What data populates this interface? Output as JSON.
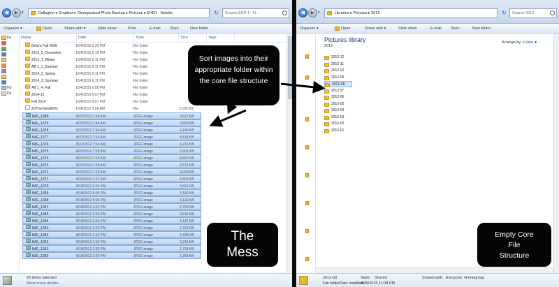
{
  "left_window": {
    "path": [
      "Gallagher",
      "Dropbox",
      "Disorganized Photo Backup",
      "Pictures",
      "EHD1 - Natalie"
    ],
    "search_placeholder": "Search EHD 1 - N...",
    "toolbar": [
      "Organize",
      "Open",
      "Share with",
      "Slide show",
      "Print",
      "E-mail",
      "Burn",
      "New folder"
    ],
    "nav_items": [
      "Fa",
      "",
      "",
      "",
      "",
      "",
      "",
      "",
      "",
      "Ho",
      "De"
    ],
    "columns": [
      "Name",
      "Date",
      "Type",
      "Size",
      "Tags"
    ],
    "rows": [
      {
        "name": "Before Fall 2009",
        "date": "10/4/2015 6:39 PM",
        "type": "File folder",
        "size": "",
        "kind": "folder",
        "selected": false
      },
      {
        "name": "2013_5_December",
        "date": "10/4/2015 6:19 PM",
        "type": "File folder",
        "size": "",
        "kind": "folder",
        "selected": false
      },
      {
        "name": "2013_1_Winter",
        "date": "10/4/2015 6:11 PM",
        "type": "File folder",
        "size": "",
        "kind": "folder",
        "selected": false
      },
      {
        "name": "AB 1_1_Summer",
        "date": "10/4/2015 6:11 PM",
        "type": "File folder",
        "size": "",
        "kind": "folder",
        "selected": false
      },
      {
        "name": "2014_2_Spring",
        "date": "10/4/2015 6:11 PM",
        "type": "File folder",
        "size": "",
        "kind": "folder",
        "selected": false
      },
      {
        "name": "2014_3_Summer",
        "date": "10/4/2015 6:11 PM",
        "type": "File folder",
        "size": "",
        "kind": "folder",
        "selected": false
      },
      {
        "name": "AB 1_4_Fall",
        "date": "10/4/2015 6:08 PM",
        "type": "File folder",
        "size": "",
        "kind": "folder",
        "selected": false
      },
      {
        "name": "2014-12",
        "date": "10/4/2015 6:07 PM",
        "type": "File folder",
        "size": "",
        "kind": "folder",
        "selected": false
      },
      {
        "name": "Fall 2014",
        "date": "10/4/2015 6:07 PM",
        "type": "File folder",
        "size": "",
        "kind": "folder",
        "selected": false
      },
      {
        "name": "ZbThumbnailInfo",
        "date": "10/4/2012 3:08 AM",
        "type": "File",
        "size": "2,285 KB",
        "kind": "file",
        "selected": false
      },
      {
        "name": "IMG_1380",
        "date": "8/22/2012 7:48 AM",
        "type": "JPEG image",
        "size": "3,527 KB",
        "kind": "image",
        "selected": true
      },
      {
        "name": "IMG_1379",
        "date": "8/22/2012 7:45 AM",
        "type": "JPEG image",
        "size": "3,559 KB",
        "kind": "image",
        "selected": true
      },
      {
        "name": "IMG_1378",
        "date": "8/22/2012 7:34 AM",
        "type": "JPEG image",
        "size": "4,140 KB",
        "kind": "image",
        "selected": true
      },
      {
        "name": "IMG_1377",
        "date": "8/22/2012 7:34 AM",
        "type": "JPEG image",
        "size": "4,518 KB",
        "kind": "image",
        "selected": true
      },
      {
        "name": "IMG_1376",
        "date": "8/22/2012 7:34 AM",
        "type": "JPEG image",
        "size": "4,219 KB",
        "kind": "image",
        "selected": true
      },
      {
        "name": "IMG_1375",
        "date": "8/22/2012 7:28 AM",
        "type": "JPEG image",
        "size": "3,902 KB",
        "kind": "image",
        "selected": true
      },
      {
        "name": "IMG_1374",
        "date": "8/22/2012 7:28 AM",
        "type": "JPEG image",
        "size": "4,665 KB",
        "kind": "image",
        "selected": true
      },
      {
        "name": "IMG_1373",
        "date": "8/22/2012 7:28 AM",
        "type": "JPEG image",
        "size": "4,572 KB",
        "kind": "image",
        "selected": true
      },
      {
        "name": "IMG_1372",
        "date": "8/22/2012 7:28 AM",
        "type": "JPEG image",
        "size": "4,029 KB",
        "kind": "image",
        "selected": true
      },
      {
        "name": "IMG_1371",
        "date": "8/22/2012 7:27 AM",
        "type": "JPEG image",
        "size": "4,501 KB",
        "kind": "image",
        "selected": true
      },
      {
        "name": "IMG_1370",
        "date": "8/18/2012 5:04 PM",
        "type": "JPEG image",
        "size": "3,551 KB",
        "kind": "image",
        "selected": true
      },
      {
        "name": "IMG_1369",
        "date": "8/18/2012 5:04 PM",
        "type": "JPEG image",
        "size": "3,180 KB",
        "kind": "image",
        "selected": true
      },
      {
        "name": "IMG_1368",
        "date": "8/18/2012 5:00 PM",
        "type": "JPEG image",
        "size": "3,100 KB",
        "kind": "image",
        "selected": true
      },
      {
        "name": "IMG_1367",
        "date": "8/18/2012 3:02 PM",
        "type": "JPEG image",
        "size": "2,750 KB",
        "kind": "image",
        "selected": true
      },
      {
        "name": "IMG_1366",
        "date": "8/18/2012 2:39 PM",
        "type": "JPEG image",
        "size": "2,615 KB",
        "kind": "image",
        "selected": true
      },
      {
        "name": "IMG_1365",
        "date": "8/18/2012 2:36 PM",
        "type": "JPEG image",
        "size": "3,147 KB",
        "kind": "image",
        "selected": true
      },
      {
        "name": "IMG_1364",
        "date": "8/18/2012 2:33 PM",
        "type": "JPEG image",
        "size": "2,753 KB",
        "kind": "image",
        "selected": true
      },
      {
        "name": "IMG_1363",
        "date": "8/18/2012 2:33 PM",
        "type": "JPEG image",
        "size": "3,438 KB",
        "kind": "image",
        "selected": true
      },
      {
        "name": "IMG_1362",
        "date": "8/18/2012 2:32 PM",
        "type": "JPEG image",
        "size": "3,216 KB",
        "kind": "image",
        "selected": true
      },
      {
        "name": "IMG_1361",
        "date": "8/18/2012 2:30 PM",
        "type": "JPEG image",
        "size": "2,733 KB",
        "kind": "image",
        "selected": true
      },
      {
        "name": "IMG_1360",
        "date": "8/18/2012 2:29 PM",
        "type": "JPEG image",
        "size": "1,368 KB",
        "kind": "image",
        "selected": true
      }
    ],
    "status_line1": "20 items selected",
    "status_line2": "Show more details..."
  },
  "right_window": {
    "path": [
      "Libraries",
      "Pictures",
      "2012"
    ],
    "search_placeholder": "Search 2012",
    "toolbar": [
      "Organize",
      "Open",
      "Share with",
      "Slide show",
      "E-mail",
      "Burn",
      "New folder"
    ],
    "library_title": "Pictures library",
    "library_sub": "2012",
    "arrange_label": "Arrange by:",
    "arrange_value": "Folder",
    "folders": [
      {
        "name": "2012-12",
        "active": false
      },
      {
        "name": "2012-11",
        "active": false
      },
      {
        "name": "2012 10",
        "active": false
      },
      {
        "name": "2012-09",
        "active": false
      },
      {
        "name": "2012-08",
        "active": true
      },
      {
        "name": "2012 07",
        "active": false
      },
      {
        "name": "2012-06",
        "active": false
      },
      {
        "name": "2012-05",
        "active": false
      },
      {
        "name": "2012-04",
        "active": false
      },
      {
        "name": "2012-03",
        "active": false
      },
      {
        "name": "2012-02",
        "active": false
      },
      {
        "name": "2012-01",
        "active": false
      }
    ],
    "status": {
      "name": "2012-08",
      "type": "File folder",
      "date_label": "Date modified:",
      "date_value": "4/25/2015 11:08 PM",
      "state_label": "State:",
      "state_value": "Shared",
      "shared_label": "Shared with:",
      "shared_value": "Everyone; Homegroup"
    }
  },
  "annotations": {
    "bubble": [
      "Sort images into their",
      "appropriate folder within",
      "the core file structure"
    ],
    "mess": [
      "The",
      "Mess"
    ],
    "empty": [
      "Empty Core",
      "File",
      "Structure"
    ]
  }
}
